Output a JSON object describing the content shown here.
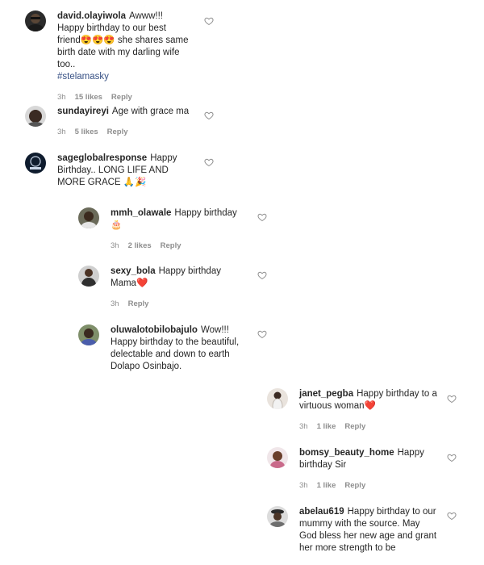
{
  "comments": [
    {
      "username": "david.olayiwola",
      "text": "Awww!!! Happy birthday to our best friend😍😍😍 she shares same birth date with my darling wife too..",
      "hashtag": "#stelamasky",
      "time": "3h",
      "likes": "15 likes",
      "reply": "Reply"
    },
    {
      "username": "sundayireyi",
      "text": "Age with grace ma",
      "time": "3h",
      "likes": "5 likes",
      "reply": "Reply"
    },
    {
      "username": "sageglobalresponse",
      "text": "Happy Birthday.. LONG LIFE AND MORE GRACE 🙏🎉",
      "time": "",
      "likes": "",
      "reply": ""
    },
    {
      "username": "mmh_olawale",
      "text": "Happy birthday 🎂",
      "time": "3h",
      "likes": "2 likes",
      "reply": "Reply"
    },
    {
      "username": "sexy_bola",
      "text": "Happy birthday Mama❤️",
      "time": "3h",
      "likes": "",
      "reply": "Reply"
    },
    {
      "username": "oluwalotobilobajulo",
      "text": "Wow!!! Happy birthday to the beautiful, delectable and down to earth Dolapo Osinbajo.",
      "time": "",
      "likes": "",
      "reply": ""
    },
    {
      "username": "janet_pegba",
      "text": "Happy birthday to a virtuous woman❤️",
      "time": "3h",
      "likes": "1 like",
      "reply": "Reply"
    },
    {
      "username": "bomsy_beauty_home",
      "text": "Happy birthday Sir",
      "time": "3h",
      "likes": "1 like",
      "reply": "Reply"
    },
    {
      "username": "abelau619",
      "text": "Happy birthday to our mummy with the source. May God bless her new age and grant her more strength to be",
      "time": "",
      "likes": "",
      "reply": ""
    }
  ],
  "icons": {
    "heart": "heart-outline-icon",
    "avatar": "avatar"
  },
  "colors": {
    "text": "#262626",
    "muted": "#8e8e8e",
    "hashtag": "#385185"
  }
}
